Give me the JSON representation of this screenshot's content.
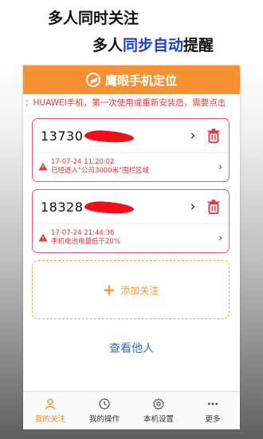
{
  "promo": {
    "line1": "多人同时关注",
    "line2_prefix": "多人",
    "line2_highlight": "同步自动",
    "line2_suffix": "提醒"
  },
  "app": {
    "title": "鹰眼手机定位",
    "notice": "：HUAWEI手机，第一次使用或重新安装后，需要点击"
  },
  "cards": [
    {
      "phone_visible": "13730",
      "time": "17-07-24 11:20:02",
      "message": "已经进入\"公司3000米\"围栏区域"
    },
    {
      "phone_visible": "18328",
      "time": "17-07-24 21:44:36",
      "message": "手机电池电量低于20%"
    }
  ],
  "add_label": "添加关注",
  "view_others": "查看他人",
  "tabs": [
    {
      "label": "我的关注",
      "icon": "person-icon",
      "active": true
    },
    {
      "label": "我的操作",
      "icon": "history-icon",
      "active": false
    },
    {
      "label": "本机设置",
      "icon": "gear-icon",
      "active": false
    },
    {
      "label": "更多",
      "icon": "more-dots-icon",
      "active": false
    }
  ],
  "colors": {
    "appbar": "#f79234",
    "accent": "#f08a2a",
    "alert": "#e0323d",
    "link": "#2e6fd1",
    "highlight": "#1f3fd0"
  }
}
